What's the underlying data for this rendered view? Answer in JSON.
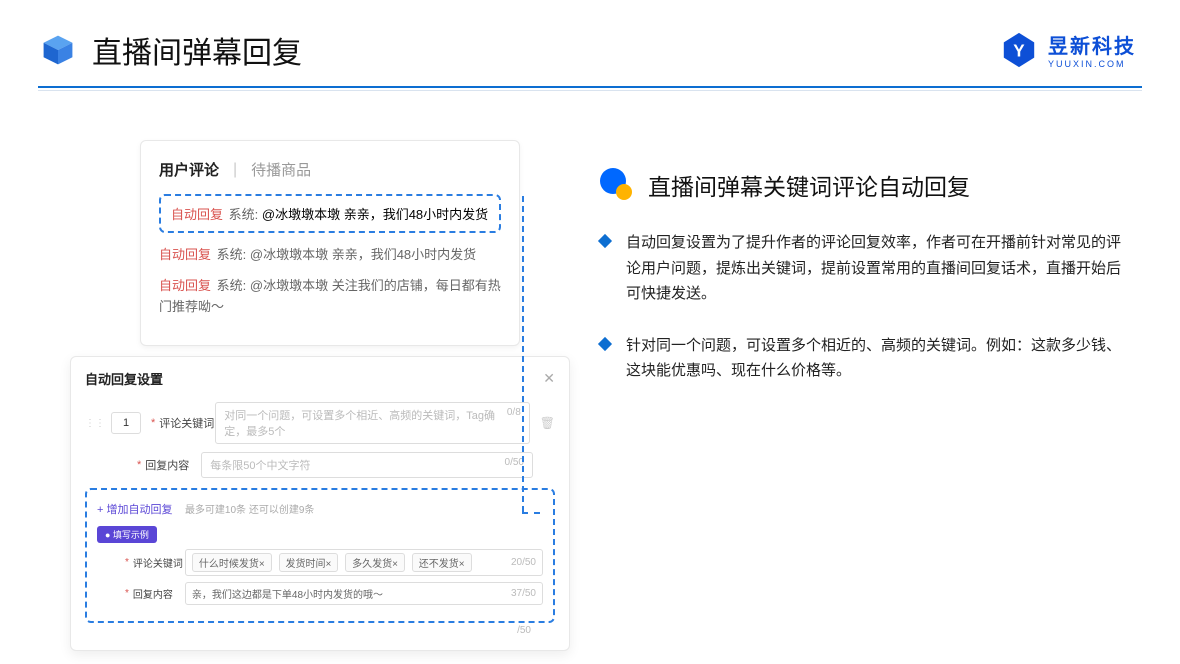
{
  "header": {
    "title": "直播间弹幕回复",
    "brand_main": "昱新科技",
    "brand_sub": "YUUXIN.COM"
  },
  "panel1": {
    "tab_active": "用户评论",
    "tab_other": "待播商品",
    "hl": {
      "auto": "自动回复",
      "sys": "系统:",
      "text": "@冰墩墩本墩 亲亲，我们48小时内发货"
    },
    "c2": {
      "auto": "自动回复",
      "sys": "系统:",
      "text": "@冰墩墩本墩 亲亲，我们48小时内发货"
    },
    "c3": {
      "auto": "自动回复",
      "sys": "系统:",
      "text": "@冰墩墩本墩 关注我们的店铺，每日都有热门推荐呦～"
    }
  },
  "panel2": {
    "title": "自动回复设置",
    "num": "1",
    "kw_label": "评论关键词",
    "kw_placeholder": "对同一个问题，可设置多个相近、高频的关键词，Tag确定，最多5个",
    "kw_count": "0/8",
    "reply_label": "回复内容",
    "reply_placeholder": "每条限50个中文字符",
    "reply_count": "0/50",
    "add_text": "+ 增加自动回复",
    "add_note": "最多可建10条 还可以创建9条",
    "ex_badge": "● 填写示例",
    "ex_kw_label": "评论关键词",
    "ex_tag1": "什么时候发货×",
    "ex_tag2": "发货时间×",
    "ex_tag3": "多久发货×",
    "ex_tag4": "还不发货×",
    "ex_kw_count": "20/50",
    "ex_reply_label": "回复内容",
    "ex_reply_text": "亲，我们这边都是下单48小时内发货的哦～",
    "ex_reply_count": "37/50",
    "below_count": "/50"
  },
  "right": {
    "title": "直播间弹幕关键词评论自动回复",
    "b1": "自动回复设置为了提升作者的评论回复效率，作者可在开播前针对常见的评论用户问题，提炼出关键词，提前设置常用的直播间回复话术，直播开始后可快捷发送。",
    "b2": "针对同一个问题，可设置多个相近的、高频的关键词。例如：这款多少钱、这块能优惠吗、现在什么价格等。"
  }
}
